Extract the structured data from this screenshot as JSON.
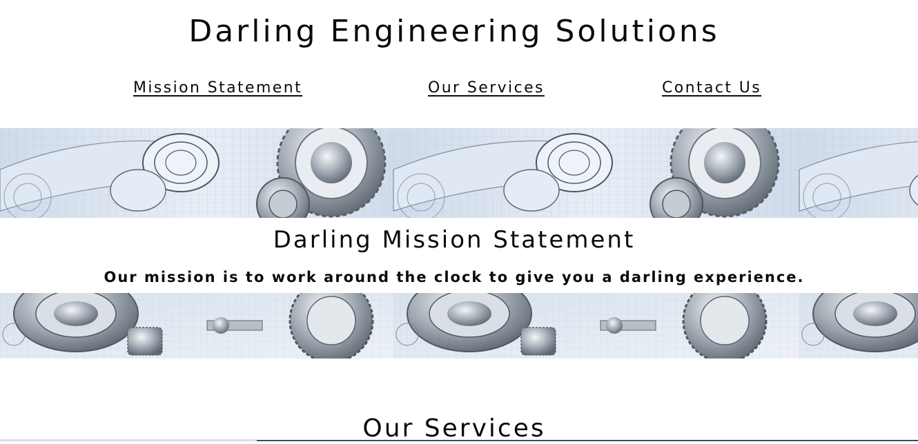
{
  "header": {
    "title": "Darling Engineering Solutions"
  },
  "nav": [
    {
      "label": "Mission Statement"
    },
    {
      "label": "Our Services"
    },
    {
      "label": "Contact Us"
    }
  ],
  "mission": {
    "heading": "Darling Mission Statement",
    "text": "Our mission is to work around the clock to give you a darling experience."
  },
  "services": {
    "heading": "Our Services"
  },
  "icons": {
    "banner_top": "engineering-gears-blueprint-image",
    "banner_bottom": "engineering-bearings-gears-image"
  },
  "colors": {
    "text": "#0a0a0a",
    "banner_tint": "#dfe8f3",
    "background": "#ffffff"
  }
}
